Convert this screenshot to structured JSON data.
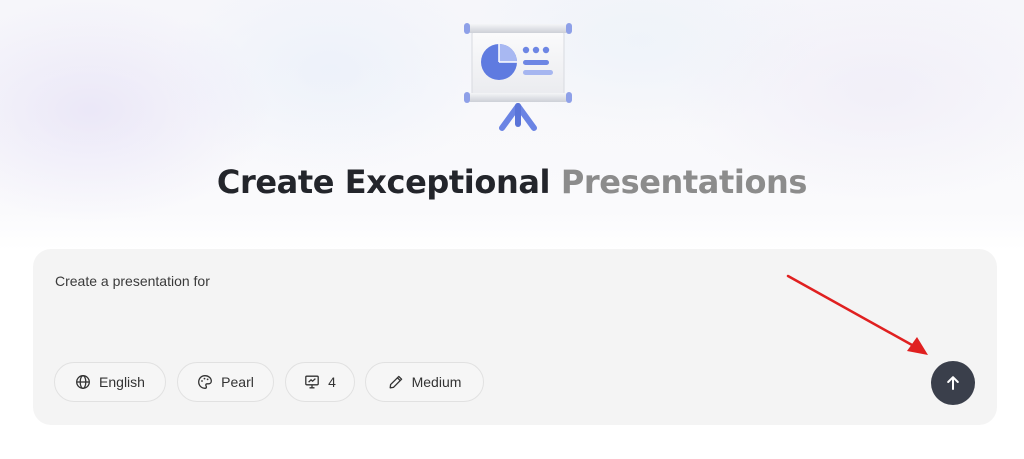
{
  "headline": {
    "main": "Create Exceptional",
    "highlight": "Presentations"
  },
  "prompt": {
    "text": "Create a presentation for"
  },
  "options": {
    "language": "English",
    "theme": "Pearl",
    "slide_count": "4",
    "length": "Medium"
  },
  "icons": {
    "hero": "presentation-board-icon",
    "language": "globe-icon",
    "theme": "palette-icon",
    "slides": "slides-icon",
    "length": "pencil-icon",
    "send": "arrow-up-icon"
  },
  "colors": {
    "send_button": "#3a3f4b",
    "headline_dark": "#23252b",
    "headline_muted": "#8c8c8c",
    "annotation": "#e02020"
  }
}
